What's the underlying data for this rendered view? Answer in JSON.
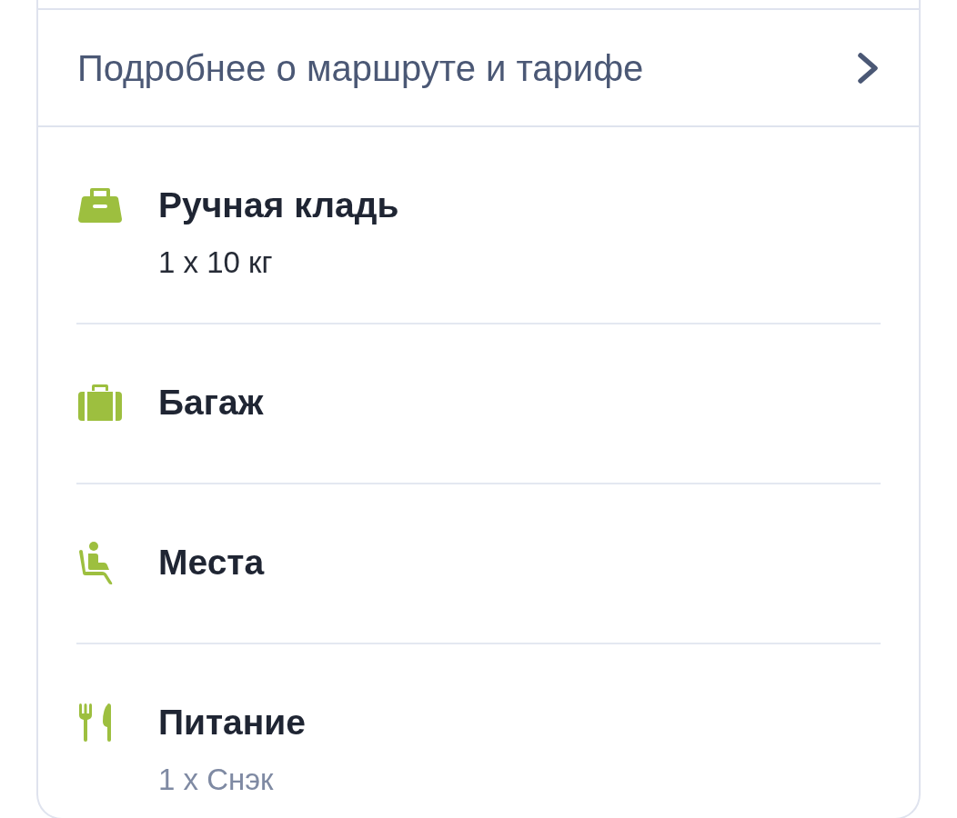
{
  "details_link": {
    "label": "Подробнее о маршруте и тарифе"
  },
  "services": [
    {
      "kind": "hand_luggage",
      "title": "Ручная кладь",
      "detail": {
        "text": "1 x 10 кг",
        "dimmed": false
      }
    },
    {
      "kind": "baggage",
      "title": "Багаж"
    },
    {
      "kind": "seat",
      "title": "Места"
    },
    {
      "kind": "meal",
      "title": "Питание",
      "detail": {
        "text": "1 x Снэк",
        "dimmed": true
      }
    }
  ]
}
